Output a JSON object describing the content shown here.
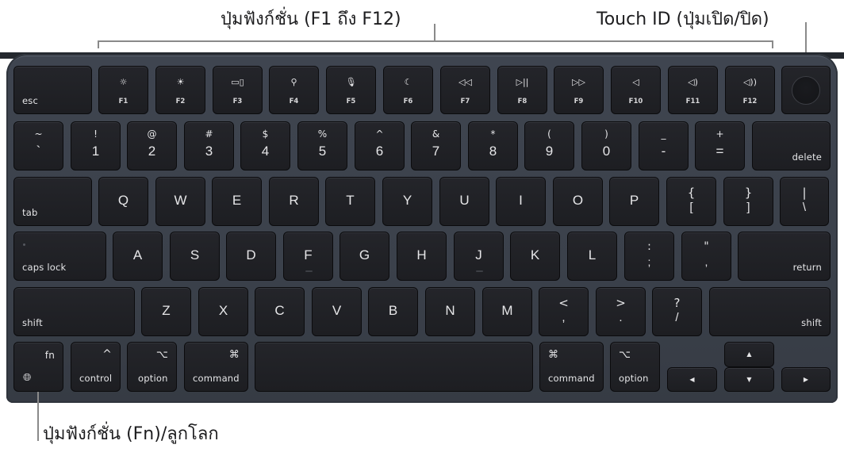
{
  "callouts": {
    "function_keys": "ปุ่มฟังก์ชั่น (F1 ถึง F12)",
    "touch_id": "Touch ID (ปุ่มเปิด/ปิด)",
    "fn_globe": "ปุ่มฟังก์ชั่น (Fn)/ลูกโลก"
  },
  "keys": {
    "esc": "esc",
    "f": [
      {
        "icon": "☼",
        "label": "F1",
        "name": "brightness-down-icon"
      },
      {
        "icon": "☀",
        "label": "F2",
        "name": "brightness-up-icon"
      },
      {
        "icon": "▭▯",
        "label": "F3",
        "name": "mission-control-icon"
      },
      {
        "icon": "⚲",
        "label": "F4",
        "name": "spotlight-search-icon"
      },
      {
        "icon": "🎙︎",
        "label": "F5",
        "name": "dictation-mic-icon"
      },
      {
        "icon": "☾",
        "label": "F6",
        "name": "do-not-disturb-moon-icon"
      },
      {
        "icon": "◁◁",
        "label": "F7",
        "name": "rewind-icon"
      },
      {
        "icon": "▷||",
        "label": "F8",
        "name": "play-pause-icon"
      },
      {
        "icon": "▷▷",
        "label": "F9",
        "name": "fast-forward-icon"
      },
      {
        "icon": "◁",
        "label": "F10",
        "name": "mute-icon"
      },
      {
        "icon": "◁)",
        "label": "F11",
        "name": "volume-down-icon"
      },
      {
        "icon": "◁))",
        "label": "F12",
        "name": "volume-up-icon"
      }
    ],
    "number_row": [
      {
        "top": "~",
        "bot": "`"
      },
      {
        "top": "!",
        "bot": "1"
      },
      {
        "top": "@",
        "bot": "2"
      },
      {
        "top": "#",
        "bot": "3"
      },
      {
        "top": "$",
        "bot": "4"
      },
      {
        "top": "%",
        "bot": "5"
      },
      {
        "top": "^",
        "bot": "6"
      },
      {
        "top": "&",
        "bot": "7"
      },
      {
        "top": "*",
        "bot": "8"
      },
      {
        "top": "(",
        "bot": "9"
      },
      {
        "top": ")",
        "bot": "0"
      },
      {
        "top": "_",
        "bot": "-"
      },
      {
        "top": "+",
        "bot": "="
      }
    ],
    "delete": "delete",
    "tab": "tab",
    "qwerty_row": [
      "Q",
      "W",
      "E",
      "R",
      "T",
      "Y",
      "U",
      "I",
      "O",
      "P"
    ],
    "bracket_keys": [
      {
        "top": "{",
        "bot": "["
      },
      {
        "top": "}",
        "bot": "]"
      },
      {
        "top": "|",
        "bot": "\\"
      }
    ],
    "caps_lock": "caps lock",
    "home_row": [
      "A",
      "S",
      "D",
      "F",
      "G",
      "H",
      "J",
      "K",
      "L"
    ],
    "home_punct": [
      {
        "top": ":",
        "bot": ";"
      },
      {
        "top": "\"",
        "bot": ","
      }
    ],
    "return": "return",
    "shift": "shift",
    "bottom_letters": [
      "Z",
      "X",
      "C",
      "V",
      "B",
      "N",
      "M"
    ],
    "bottom_punct": [
      {
        "top": "<",
        "bot": ","
      },
      {
        "top": ">",
        "bot": "."
      },
      {
        "top": "?",
        "bot": "/"
      }
    ],
    "fn": "fn",
    "globe_icon": "🌐︎",
    "control": "control",
    "control_symbol": "^",
    "option": "option",
    "option_symbol": "⌥",
    "command": "command",
    "command_symbol": "⌘",
    "arrows": {
      "up": "▲",
      "down": "▼",
      "left": "◀",
      "right": "▶"
    }
  }
}
